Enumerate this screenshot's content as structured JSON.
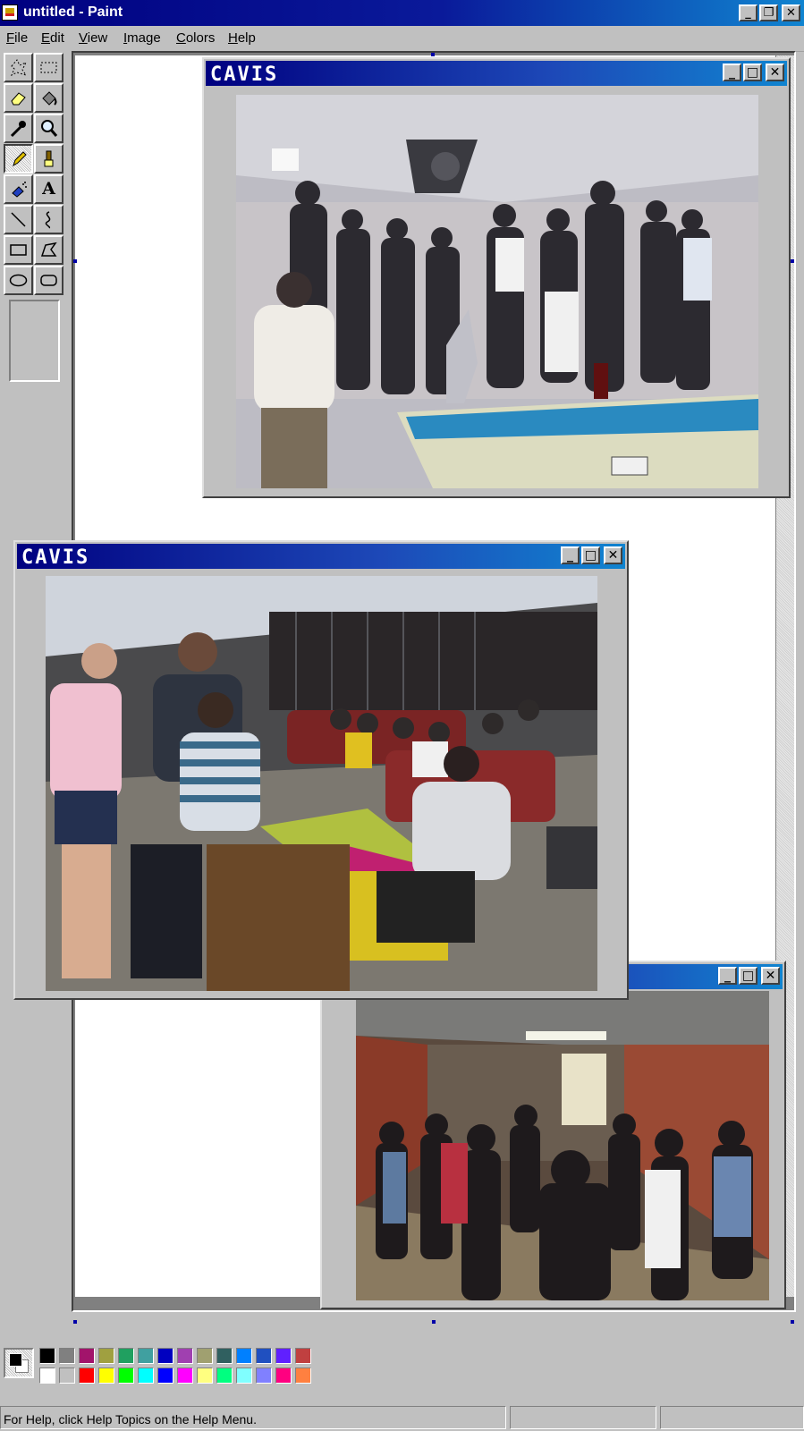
{
  "app": {
    "title": "untitled - Paint",
    "window_buttons": [
      "_",
      "❐",
      "✕"
    ]
  },
  "menu": [
    {
      "hot": "F",
      "rest": "ile"
    },
    {
      "hot": "E",
      "rest": "dit"
    },
    {
      "hot": "V",
      "rest": "iew"
    },
    {
      "hot": "I",
      "rest": "mage"
    },
    {
      "hot": "C",
      "rest": "olors"
    },
    {
      "hot": "H",
      "rest": "elp"
    }
  ],
  "tools": [
    "free-form-select-icon",
    "select-icon",
    "eraser-icon",
    "fill-icon",
    "pick-color-icon",
    "magnifier-icon",
    "pencil-icon",
    "brush-icon",
    "airbrush-icon",
    "text-icon",
    "line-icon",
    "curve-icon",
    "rectangle-icon",
    "polygon-icon",
    "ellipse-icon",
    "rounded-rectangle-icon"
  ],
  "active_tool": "pencil-icon",
  "windows": [
    {
      "title": "CAVIS",
      "photo": "pool-table-party"
    },
    {
      "title": "CAVIS",
      "photo": "lounge-table"
    },
    {
      "title": "",
      "photo": "hallway-crowd"
    }
  ],
  "window_buttons": [
    "_",
    "□",
    "✕"
  ],
  "palette": {
    "foreground": "#000000",
    "background": "#ffffff",
    "top_row": [
      "#000000",
      "#808080",
      "#a2146b",
      "#a0a040",
      "#20a060",
      "#40a0a0",
      "#0000c0",
      "#a040b0",
      "#a0a070",
      "#306060",
      "#0080ff",
      "#2050c0",
      "#6020ff",
      "#c04040"
    ],
    "bottom_row": [
      "#ffffff",
      "#c0c0c0",
      "#ff0000",
      "#ffff00",
      "#00ff00",
      "#00ffff",
      "#0000ff",
      "#ff00ff",
      "#ffff80",
      "#00ff80",
      "#80ffff",
      "#8080ff",
      "#ff0080",
      "#ff8040"
    ]
  },
  "status": {
    "help_text": "For Help, click Help Topics on the Help Menu."
  }
}
